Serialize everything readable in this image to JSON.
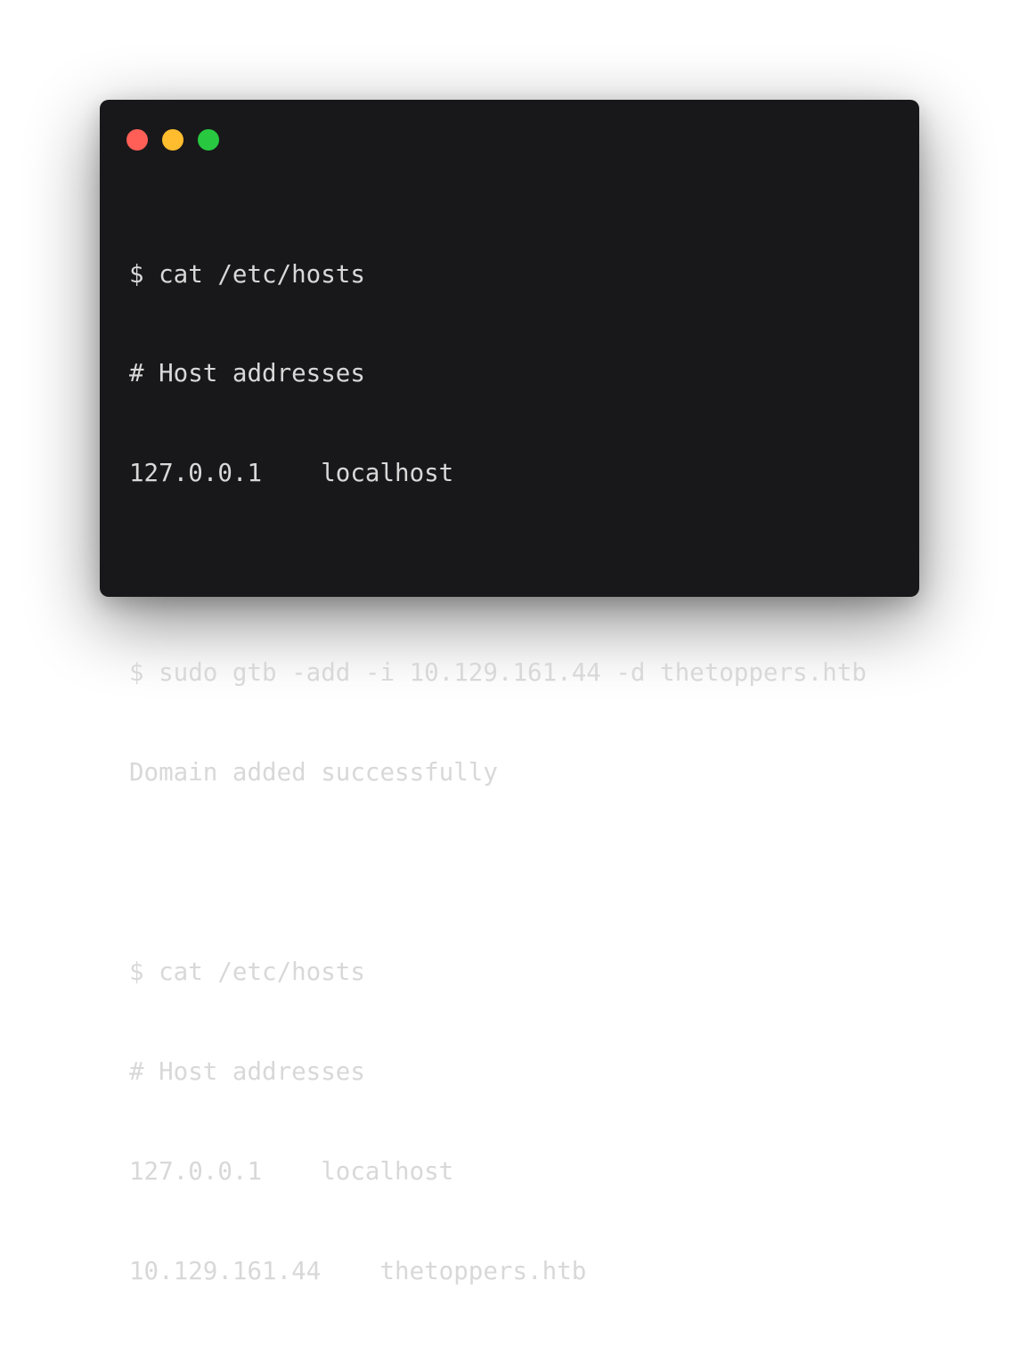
{
  "window": {
    "controls": [
      {
        "name": "close-button",
        "color": "#ff5f57"
      },
      {
        "name": "minimize-button",
        "color": "#febc2e"
      },
      {
        "name": "zoom-button",
        "color": "#28c840"
      }
    ]
  },
  "terminal": {
    "lines": [
      "$ cat /etc/hosts",
      "# Host addresses",
      "127.0.0.1    localhost",
      "",
      "$ sudo gtb -add -i 10.129.161.44 -d thetoppers.htb",
      "Domain added successfully",
      "",
      "$ cat /etc/hosts",
      "# Host addresses",
      "127.0.0.1    localhost",
      "10.129.161.44    thetoppers.htb"
    ]
  },
  "colors": {
    "window_background": "#18181a",
    "text": "#d8d8d8",
    "page_background": "#ffffff"
  }
}
